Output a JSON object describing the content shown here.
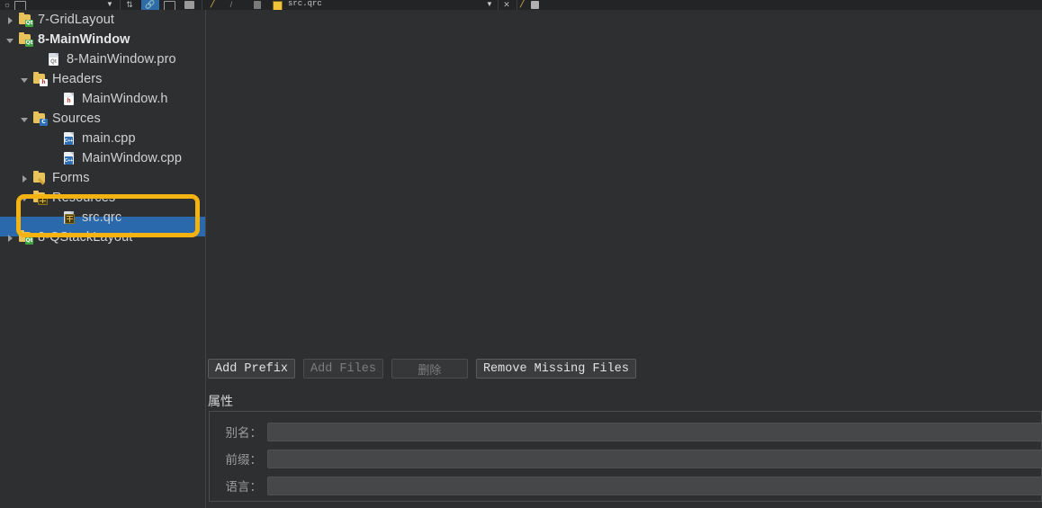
{
  "toolbar": {
    "tab_label": "src.qrc",
    "icons": [
      {
        "name": "split-horizontal-icon"
      },
      {
        "name": "split-vertical-icon"
      },
      {
        "name": "dropdown-arrow-icon"
      },
      {
        "name": "sync-icon"
      },
      {
        "name": "link-icon"
      },
      {
        "name": "close-icon"
      },
      {
        "name": "pencil-icon"
      }
    ]
  },
  "tree": {
    "items": [
      {
        "label": "7-GridLayout",
        "icon": "qt-project-folder-icon",
        "indent": 6,
        "twisty": "closed",
        "bold": false,
        "name": "tree-item-7-gridlayout"
      },
      {
        "label": "8-MainWindow",
        "icon": "qt-project-folder-icon",
        "indent": 6,
        "twisty": "open",
        "bold": true,
        "name": "tree-item-8-mainwindow"
      },
      {
        "label": "8-MainWindow.pro",
        "icon": "qt-pro-file-icon",
        "indent": 38,
        "twisty": "none",
        "bold": false,
        "name": "tree-item-8-mainwindow-pro"
      },
      {
        "label": "Headers",
        "icon": "headers-folder-icon",
        "indent": 22,
        "twisty": "open",
        "bold": false,
        "name": "tree-item-headers"
      },
      {
        "label": "MainWindow.h",
        "icon": "h-file-icon",
        "indent": 55,
        "twisty": "none",
        "bold": false,
        "name": "tree-item-mainwindow-h"
      },
      {
        "label": "Sources",
        "icon": "sources-folder-icon",
        "indent": 22,
        "twisty": "open",
        "bold": false,
        "name": "tree-item-sources"
      },
      {
        "label": "main.cpp",
        "icon": "cpp-file-icon",
        "indent": 55,
        "twisty": "none",
        "bold": false,
        "name": "tree-item-main-cpp"
      },
      {
        "label": "MainWindow.cpp",
        "icon": "cpp-file-icon",
        "indent": 55,
        "twisty": "none",
        "bold": false,
        "name": "tree-item-mainwindow-cpp"
      },
      {
        "label": "Forms",
        "icon": "forms-folder-icon",
        "indent": 22,
        "twisty": "closed",
        "bold": false,
        "name": "tree-item-forms"
      },
      {
        "label": "Resources",
        "icon": "resources-folder-icon",
        "indent": 22,
        "twisty": "open",
        "bold": false,
        "name": "tree-item-resources"
      },
      {
        "label": "src.qrc",
        "icon": "qrc-file-icon",
        "indent": 55,
        "twisty": "none",
        "bold": false,
        "selected": true,
        "name": "tree-item-src-qrc"
      },
      {
        "label": "8-QStackLayout",
        "icon": "qt-project-folder-icon",
        "indent": 6,
        "twisty": "closed",
        "bold": false,
        "name": "tree-item-8-qstacklayout"
      }
    ],
    "selected_label": "src.qrc",
    "annotation_color": "#f5b312",
    "selection_color": "#2a69ab"
  },
  "editor": {
    "buttons": [
      {
        "label": "Add Prefix",
        "enabled": true,
        "name": "add-prefix-button"
      },
      {
        "label": "Add Files",
        "enabled": false,
        "name": "add-files-button"
      },
      {
        "label": "删除",
        "enabled": false,
        "name": "delete-button"
      },
      {
        "label": "Remove Missing Files",
        "enabled": true,
        "name": "remove-missing-files-button"
      }
    ],
    "properties_title": "属性",
    "fields": [
      {
        "label": "别名：",
        "value": "",
        "name": "alias-field"
      },
      {
        "label": "前缀：",
        "value": "",
        "name": "prefix-field"
      },
      {
        "label": "语言：",
        "value": "",
        "name": "language-field"
      }
    ]
  }
}
